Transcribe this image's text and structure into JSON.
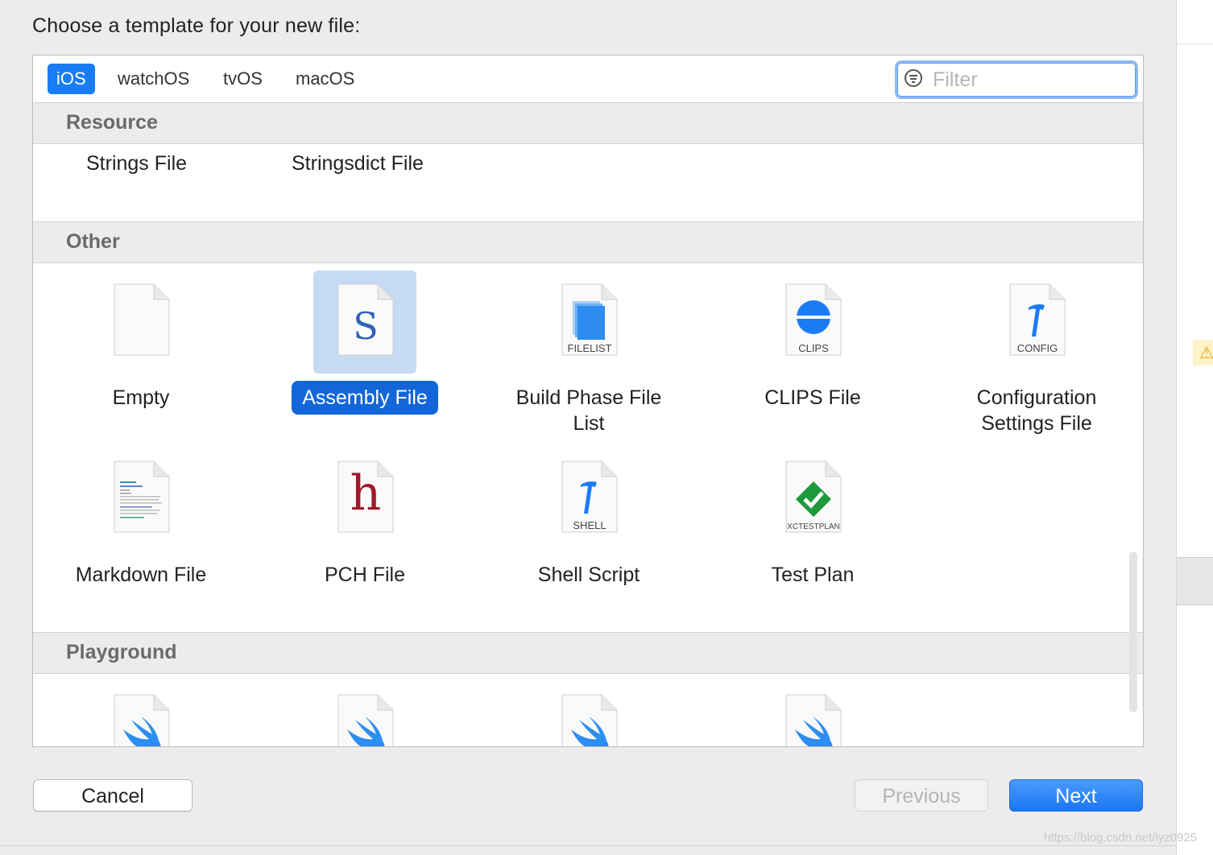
{
  "prompt": "Choose a template for your new file:",
  "tabs": [
    {
      "label": "iOS",
      "active": true
    },
    {
      "label": "watchOS",
      "active": false
    },
    {
      "label": "tvOS",
      "active": false
    },
    {
      "label": "macOS",
      "active": false
    }
  ],
  "filter": {
    "placeholder": "Filter",
    "value": ""
  },
  "sections": [
    {
      "title": "Resource",
      "items": [
        "Strings File",
        "Stringsdict File"
      ]
    },
    {
      "title": "Other",
      "items": [
        {
          "label": "Empty",
          "icon": "blank-document-icon"
        },
        {
          "label": "Assembly File",
          "icon": "assembly-s-icon",
          "selected": true,
          "glyph": "S"
        },
        {
          "label_lines": [
            "Build Phase File",
            "List"
          ],
          "icon": "filelist-icon",
          "tag": "FILELIST"
        },
        {
          "label": "CLIPS File",
          "icon": "clips-icon",
          "tag": "CLIPS"
        },
        {
          "label_lines": [
            "Configuration",
            "Settings File"
          ],
          "icon": "config-icon",
          "tag": "CONFIG"
        },
        {
          "label": "Markdown File",
          "icon": "markdown-icon"
        },
        {
          "label": "PCH File",
          "icon": "pch-h-icon",
          "glyph": "h"
        },
        {
          "label": "Shell Script",
          "icon": "shell-icon",
          "tag": "SHELL"
        },
        {
          "label": "Test Plan",
          "icon": "testplan-icon",
          "tag": "XCTESTPLAN"
        }
      ]
    },
    {
      "title": "Playground",
      "items": [
        {
          "icon": "swift-icon"
        },
        {
          "icon": "swift-icon"
        },
        {
          "icon": "swift-icon"
        },
        {
          "icon": "swift-icon"
        }
      ]
    }
  ],
  "buttons": {
    "cancel": "Cancel",
    "previous": "Previous",
    "next": "Next"
  },
  "watermark": "https://blog.csdn.net/lyz0925",
  "colors": {
    "accent": "#1a7cf5",
    "selection_bg": "#c6daf4",
    "selection_label": "#1266d8"
  }
}
